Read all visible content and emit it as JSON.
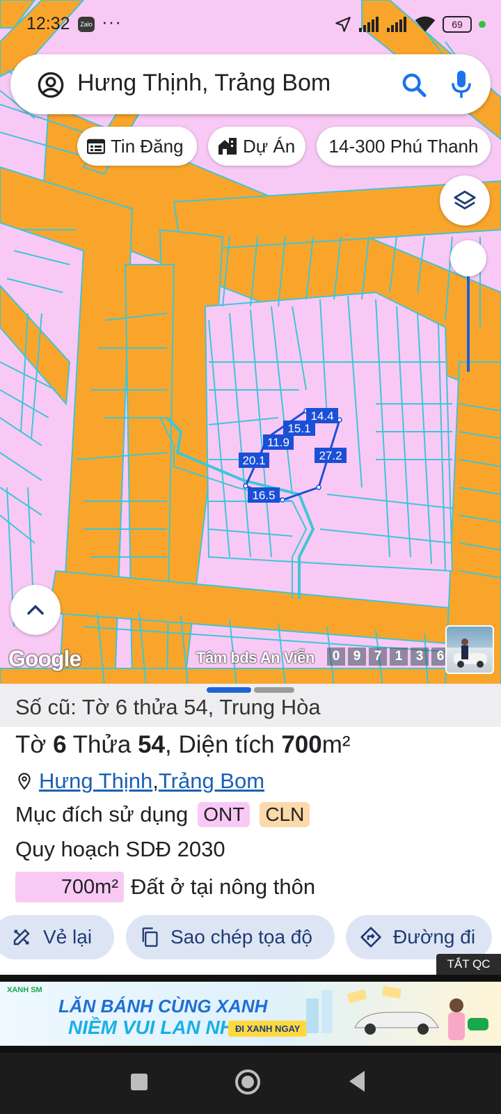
{
  "status_bar": {
    "time": "12:32",
    "app_icon": "Zalo",
    "more": "···",
    "battery": "69",
    "icons": [
      "location-arrow-icon",
      "signal-icon",
      "signal-icon",
      "wifi-icon",
      "battery-icon"
    ]
  },
  "search": {
    "query": "Hưng Thịnh, Trảng Bom",
    "icons": [
      "account-icon",
      "search-icon",
      "mic-icon"
    ]
  },
  "chips": [
    {
      "label": "Tin Đăng",
      "icon": "calendar-list-icon"
    },
    {
      "label": "Dự Án",
      "icon": "buildings-icon"
    },
    {
      "label": "14-300 Phú Thanh"
    }
  ],
  "map": {
    "parcel_lengths": [
      "14.4",
      "15.1",
      "11.9",
      "20.1",
      "27.2",
      "16.5"
    ],
    "attribution": "Google",
    "watermark": "Tâm bds An Viễn",
    "watermark_digits": [
      "0",
      "9",
      "7",
      "1",
      "3",
      "6"
    ],
    "colors": {
      "residential": "#f9c9f5",
      "road": "#f9a52b",
      "lot_line": "#3ec6d6",
      "parcel_outline": "#1a4fd6"
    }
  },
  "sheet": {
    "old_info": "Số cũ: Tờ 6 thửa 54, Trung Hòa",
    "title_pre": "Tờ ",
    "to_no": "6",
    "title_mid": " Thửa ",
    "thua_no": "54",
    "title_area_label": ", Diện tích ",
    "area": "700",
    "unit": "m²",
    "location_links": [
      "Hưng Thịnh",
      "Trảng Bom"
    ],
    "location_sep": ", ",
    "purpose_label": "Mục đích sử dụng",
    "purpose_tags": [
      {
        "code": "ONT",
        "color": "#f9c9f5"
      },
      {
        "code": "CLN",
        "color": "#fcd9a8"
      }
    ],
    "plan_label": "Quy hoạch SDĐ 2030",
    "plan_area": "700m²",
    "plan_desc": "Đất ở tại nông thôn"
  },
  "actions": [
    {
      "label": "Vẻ lại",
      "icon": "pencil-ruler-icon"
    },
    {
      "label": "Sao chép tọa độ",
      "icon": "copy-icon"
    },
    {
      "label": "Đường đi",
      "icon": "directions-icon"
    }
  ],
  "ad": {
    "close_label": "TẮT QC",
    "brand": "XANH SM",
    "line1": "LĂN BÁNH CÙNG XANH",
    "line2": "NIỀM VUI LAN NHANH",
    "cta": "ĐI XANH NGAY"
  }
}
